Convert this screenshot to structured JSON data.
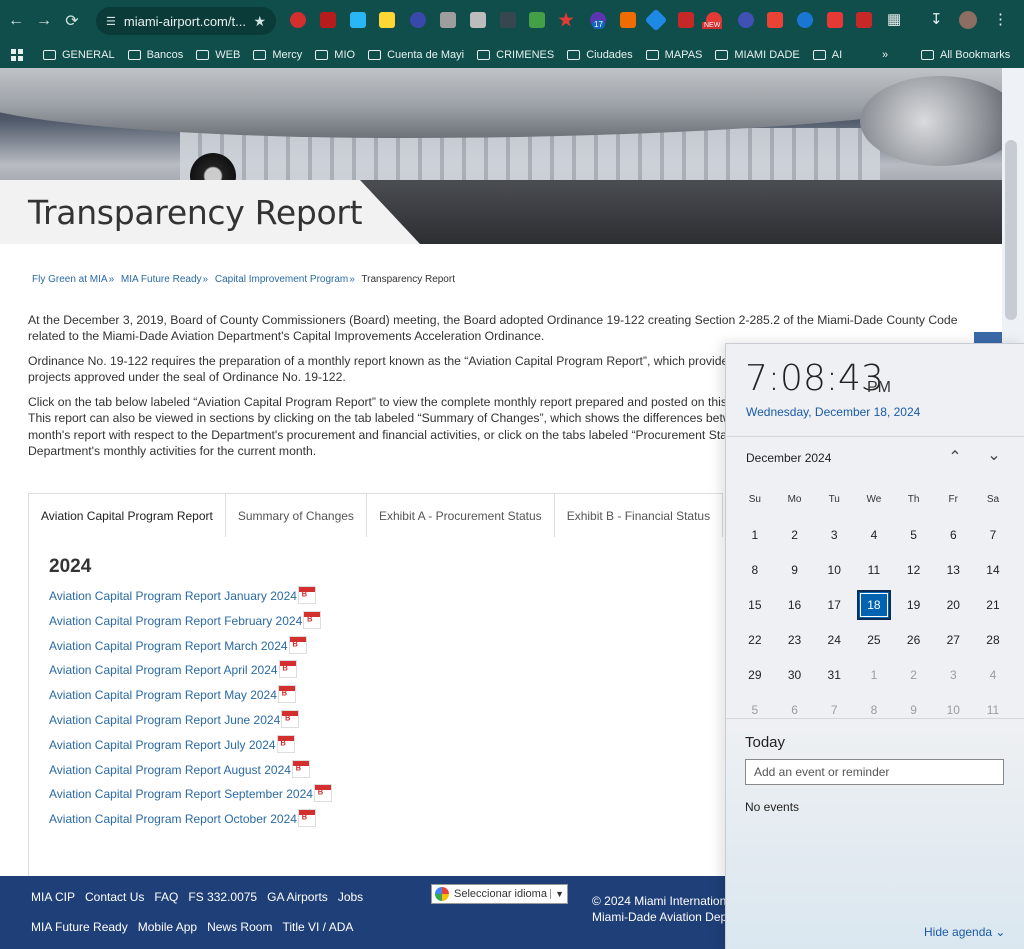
{
  "browser": {
    "url": "miami-airport.com/t...",
    "bookmarks": [
      "GENERAL",
      "Bancos",
      "WEB",
      "Mercy",
      "MIO",
      "Cuenta de Mayi",
      "CRIMENES",
      "Ciudades",
      "MAPAS",
      "MIAMI DADE",
      "AI"
    ],
    "all_bookmarks": "All Bookmarks",
    "more_bookmarks": "»",
    "badge_count": "17",
    "badge_new": "NEW"
  },
  "page": {
    "title": "Transparency Report",
    "breadcrumb": [
      "Fly Green at MIA",
      "MIA Future Ready",
      "Capital Improvement Program"
    ],
    "breadcrumb_current": "Transparency Report",
    "breadcrumb_sep": "»",
    "intro": [
      "At the December 3, 2019, Board of County Commissioners (Board) meeting, the Board adopted Ordinance 19-122 creating Section 2-285.2 of the Miami-Dade County Code related to the Miami-Dade Aviation Department's Capital Improvements Acceleration Ordinance.",
      "Ordinance No. 19-122 requires the preparation of a monthly report known as the “Aviation Capital Program Report”, which provides the",
      "projects approved under the seal of Ordinance No. 19-122.",
      "Click on the tab below labeled “Aviation Capital Program Report” to view the complete monthly report prepared and posted on this we",
      "This report can also be viewed in sections by clicking on the tab labeled  “Summary of Changes”, which shows the differences between",
      "month's report with respect to the Department's procurement and financial activities, or click on the tabs labeled “Procurement Status”",
      "Department's monthly activities for the current month."
    ],
    "tabs": [
      "Aviation Capital Program Report",
      "Summary of Changes",
      "Exhibit A - Procurement Status",
      "Exhibit B - Financial Status"
    ],
    "year": "2024",
    "reports": [
      "Aviation Capital Program Report January 2024",
      "Aviation Capital Program Report February 2024",
      "Aviation Capital Program Report March 2024",
      "Aviation Capital Program Report April 2024",
      "Aviation Capital Program Report May 2024",
      "Aviation Capital Program Report June 2024",
      "Aviation Capital Program Report July 2024",
      "Aviation Capital Program Report August 2024",
      "Aviation Capital Program Report September 2024",
      "Aviation Capital Program Report October 2024"
    ],
    "footer": {
      "row1": [
        "MIA CIP",
        "Contact Us",
        "FAQ",
        "FS 332.0075",
        "GA Airports",
        "Jobs"
      ],
      "row2": [
        "MIA Future Ready",
        "Mobile App",
        "News Room",
        "Title VI / ADA"
      ],
      "translate": "Seleccionar idioma",
      "copyright1": "© 2024 Miami Internation",
      "copyright2": "Miami-Dade Aviation Dep"
    }
  },
  "flyout": {
    "time": "7:08:43",
    "ampm": "PM",
    "date": "Wednesday, December 18, 2024",
    "month": "December 2024",
    "weekdays": [
      "Su",
      "Mo",
      "Tu",
      "We",
      "Th",
      "Fr",
      "Sa"
    ],
    "weeks": [
      [
        "1",
        "2",
        "3",
        "4",
        "5",
        "6",
        "7"
      ],
      [
        "8",
        "9",
        "10",
        "11",
        "12",
        "13",
        "14"
      ],
      [
        "15",
        "16",
        "17",
        "18",
        "19",
        "20",
        "21"
      ],
      [
        "22",
        "23",
        "24",
        "25",
        "26",
        "27",
        "28"
      ],
      [
        "29",
        "30",
        "31",
        "1",
        "2",
        "3",
        "4"
      ],
      [
        "5",
        "6",
        "7",
        "8",
        "9",
        "10",
        "11"
      ]
    ],
    "today_day": "18",
    "today_label": "Today",
    "event_placeholder": "Add an event or reminder",
    "no_events": "No events",
    "hide_agenda": "Hide agenda"
  }
}
